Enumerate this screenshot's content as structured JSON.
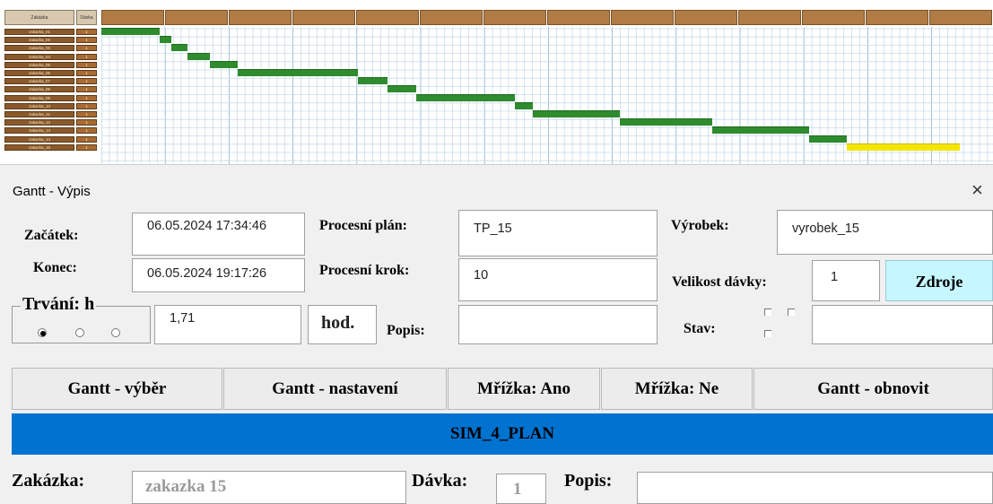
{
  "gantt": {
    "header_left": [
      "Zakázka",
      "Dávka"
    ],
    "rows": [
      {
        "label": "zakazka_01",
        "qty": "1"
      },
      {
        "label": "zakazka_02",
        "qty": "1"
      },
      {
        "label": "zakazka_03",
        "qty": "1"
      },
      {
        "label": "zakazka_04",
        "qty": "1"
      },
      {
        "label": "zakazka_05",
        "qty": "1"
      },
      {
        "label": "zakazka_06",
        "qty": "1"
      },
      {
        "label": "zakazka_07",
        "qty": "1"
      },
      {
        "label": "zakazka_08",
        "qty": "1"
      },
      {
        "label": "zakazka_09",
        "qty": "1"
      },
      {
        "label": "zakazka_10",
        "qty": "1"
      },
      {
        "label": "zakazka_11",
        "qty": "1"
      },
      {
        "label": "zakazka_12",
        "qty": "1"
      },
      {
        "label": "zakazka_13",
        "qty": "1"
      },
      {
        "label": "zakazka_14",
        "qty": "1"
      },
      {
        "label": "zakazka_15",
        "qty": "1"
      }
    ],
    "bar_color": "#2e8b2e",
    "selected_bar_color": "#f5e600"
  },
  "dialog": {
    "title": "Gantt - Výpis",
    "close": "×",
    "zacatek_label": "Začátek:",
    "zacatek_value": "06.05.2024 17:34:46",
    "konec_label": "Konec:",
    "konec_value": "06.05.2024 19:17:26",
    "trvani_label": "Trvání: h",
    "trvani_value": "1,71",
    "hod_label": "hod.",
    "procesni_plan_label": "Procesní plán:",
    "procesni_plan_value": "TP_15",
    "procesni_krok_label": "Procesní krok:",
    "procesni_krok_value": "10",
    "popis_label": "Popis:",
    "popis_value": "",
    "vyrobek_label": "Výrobek:",
    "vyrobek_value": "vyrobek_15",
    "velikost_label": "Velikost dávky:",
    "velikost_value": "1",
    "zdroje_button": "Zdroje",
    "stav_label": "Stav:",
    "stav_value": ""
  },
  "buttons": {
    "gantt_vyber": "Gantt - výběr",
    "gantt_nastaveni": "Gantt - nastavení",
    "mrizka_ano": "Mřížka: Ano",
    "mrizka_ne": "Mřížka: Ne",
    "gantt_obnovit": "Gantt - obnovit"
  },
  "plan_banner": {
    "text": "SIM_4_PLAN",
    "color": "#0073d1"
  },
  "bottom": {
    "zakazka_label": "Zakázka:",
    "zakazka_value": "zakazka 15",
    "davka_label": "Dávka:",
    "davka_value": "1",
    "popis_label": "Popis:",
    "popis_value": ""
  }
}
